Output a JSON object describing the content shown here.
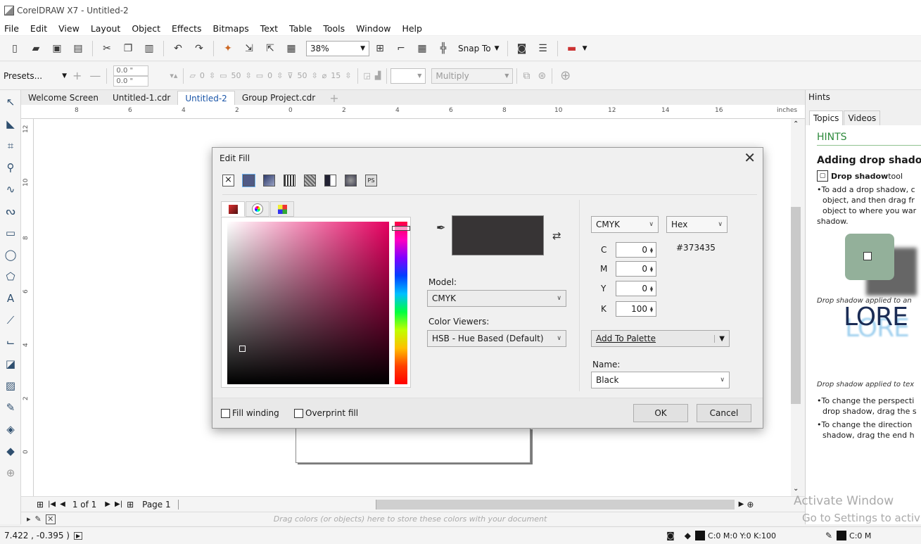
{
  "window": {
    "title": "CorelDRAW X7 - Untitled-2"
  },
  "menu": [
    "File",
    "Edit",
    "View",
    "Layout",
    "Object",
    "Effects",
    "Bitmaps",
    "Text",
    "Table",
    "Tools",
    "Window",
    "Help"
  ],
  "toolbar": {
    "zoom": "38%",
    "snap_to": "Snap To"
  },
  "property_bar": {
    "presets": "Presets...",
    "nudge_x": "0.0 \"",
    "nudge_y": "0.0 \"",
    "shadow_offset": "0",
    "opacity": "50",
    "feather": "0",
    "stretch": "50",
    "fade": "15",
    "blend_mode": "Multiply"
  },
  "doc_tabs": [
    "Welcome Screen",
    "Untitled-1.cdr",
    "Untitled-2",
    "Group Project.cdr",
    "+"
  ],
  "active_tab_index": 2,
  "ruler": {
    "h_ticks": [
      "8",
      "6",
      "4",
      "2",
      "0",
      "2",
      "4",
      "6",
      "8",
      "10",
      "12",
      "14",
      "16"
    ],
    "units": "inches",
    "v_ticks": [
      "12",
      "10",
      "8",
      "6",
      "4",
      "2",
      "0"
    ]
  },
  "page_nav": {
    "page_count": "1 of 1",
    "page_tab": "Page 1"
  },
  "palette_line": {
    "hint": "Drag colors (or objects) here to store these colors with your document"
  },
  "status": {
    "coords": "7.422 , -0.395 )",
    "fill_info": "C:0 M:0 Y:0 K:100",
    "outline_info": "C:0 M"
  },
  "dialog": {
    "title": "Edit Fill",
    "model_label": "Model:",
    "model_value": "CMYK",
    "viewers_label": "Color Viewers:",
    "viewers_value": "HSB - Hue Based (Default)",
    "color_mode": "CMYK",
    "value_format": "Hex",
    "hex_value": "#373435",
    "channels": [
      {
        "label": "C",
        "value": "0"
      },
      {
        "label": "M",
        "value": "0"
      },
      {
        "label": "Y",
        "value": "0"
      },
      {
        "label": "K",
        "value": "100"
      }
    ],
    "add_to_palette": "Add To Palette",
    "name_label": "Name:",
    "name_value": "Black",
    "fill_winding": "Fill winding",
    "overprint_fill": "Overprint fill",
    "ok": "OK",
    "cancel": "Cancel",
    "swatch_color": "#373435"
  },
  "hints": {
    "panel_title": "Hints",
    "tabs": [
      "Topics",
      "Videos"
    ],
    "heading": "HINTS",
    "subheading": "Adding drop shado",
    "tool_name": "Drop shadow",
    "tool_suffix": " tool",
    "line1": "•To add a drop shadow, c",
    "line2": "object, and then drag fr",
    "line3": "object to where you war",
    "line4": "shadow.",
    "caption1": "Drop shadow applied to an",
    "lorem": "LORE",
    "caption2": "Drop shadow applied to tex",
    "bullet2a": "•To change the perspecti",
    "bullet2b": "drop shadow, drag the s",
    "bullet3a": "•To change the direction",
    "bullet3b": "shadow, drag the end h"
  },
  "watermark": {
    "line1": "Activate Window",
    "line2": "Go to Settings to activ"
  }
}
